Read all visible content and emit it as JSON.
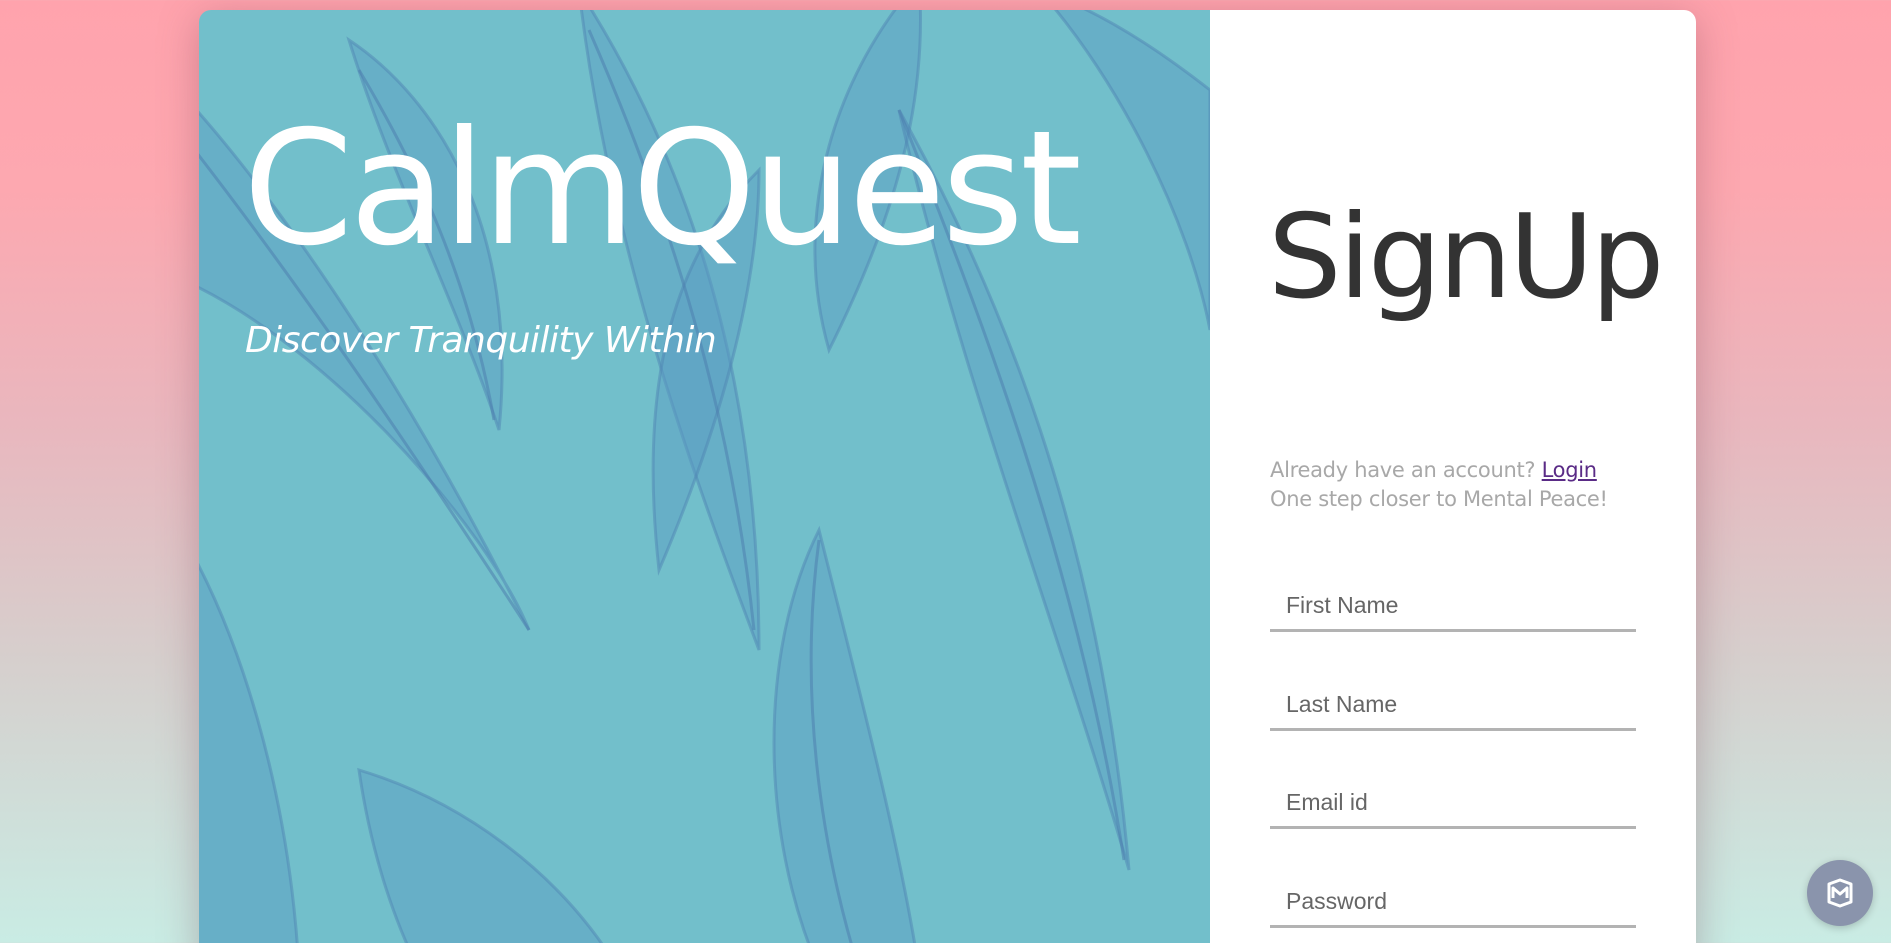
{
  "hero": {
    "brand": "CalmQuest",
    "tagline": "Discover Tranquility Within"
  },
  "signup": {
    "title": "SignUp",
    "already_text": "Already have an account?",
    "login_link": "Login",
    "subtitle": "One step closer to Mental Peace!",
    "fields": {
      "first_name": {
        "placeholder": "First Name",
        "value": ""
      },
      "last_name": {
        "placeholder": "Last Name",
        "value": ""
      },
      "email": {
        "placeholder": "Email id",
        "value": ""
      },
      "password": {
        "placeholder": "Password",
        "value": ""
      }
    }
  },
  "widget": {
    "icon": "shield-m-icon"
  },
  "colors": {
    "hero_background": "#72bfcb",
    "feather": "#5b9cc4",
    "title_text": "#333333",
    "muted_text": "#a8a8a8",
    "link": "#5a2b86",
    "widget_bg": "#8a94ac"
  }
}
